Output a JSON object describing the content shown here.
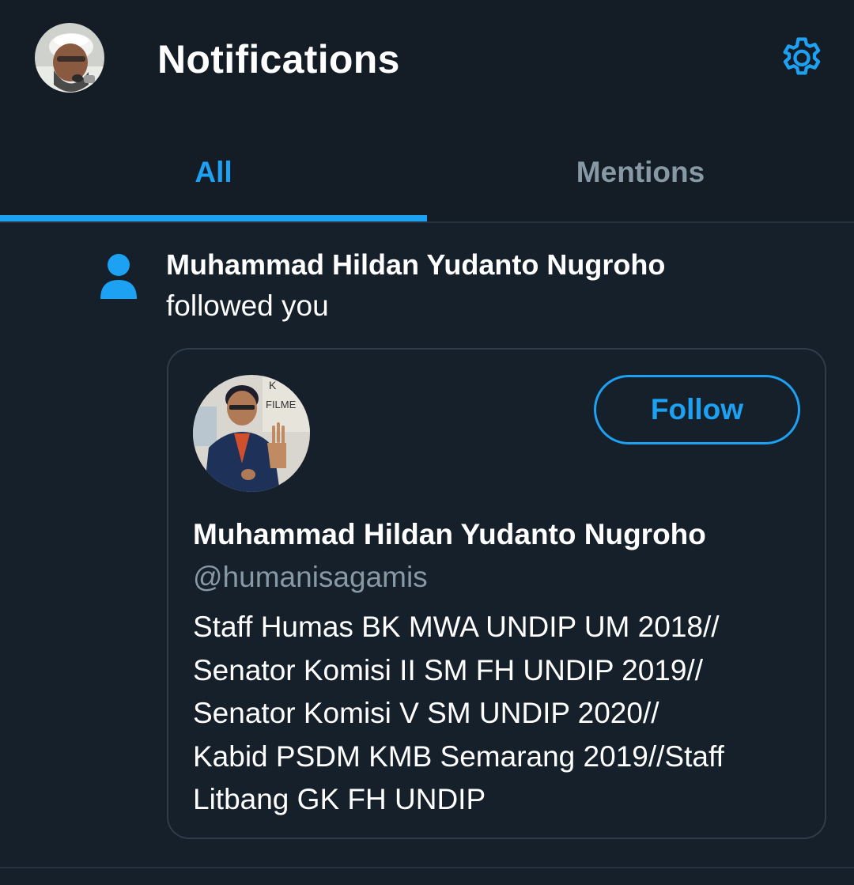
{
  "header": {
    "title": "Notifications",
    "avatar_icon": "user-avatar-photo",
    "settings_icon": "gear-icon"
  },
  "tabs": [
    {
      "label": "All",
      "active": true
    },
    {
      "label": "Mentions",
      "active": false
    }
  ],
  "notification": {
    "icon": "person-icon",
    "name": "Muhammad Hildan Yudanto Nugroho",
    "action": "followed you",
    "card": {
      "name": "Muhammad Hildan Yudanto Nugroho",
      "handle": "@humanisagamis",
      "follow_label": "Follow",
      "bio_lines": [
        "Staff Humas BK MWA UNDIP UM 2018//",
        "Senator Komisi II SM FH UNDIP 2019//",
        "Senator Komisi V SM UNDIP 2020//",
        "Kabid PSDM KMB Semarang 2019//Staff",
        "Litbang GK FH UNDIP"
      ]
    }
  },
  "colors": {
    "accent": "#1da1f2",
    "background": "#15202b",
    "header_background": "#141d26",
    "secondary_text": "#8899a6"
  }
}
